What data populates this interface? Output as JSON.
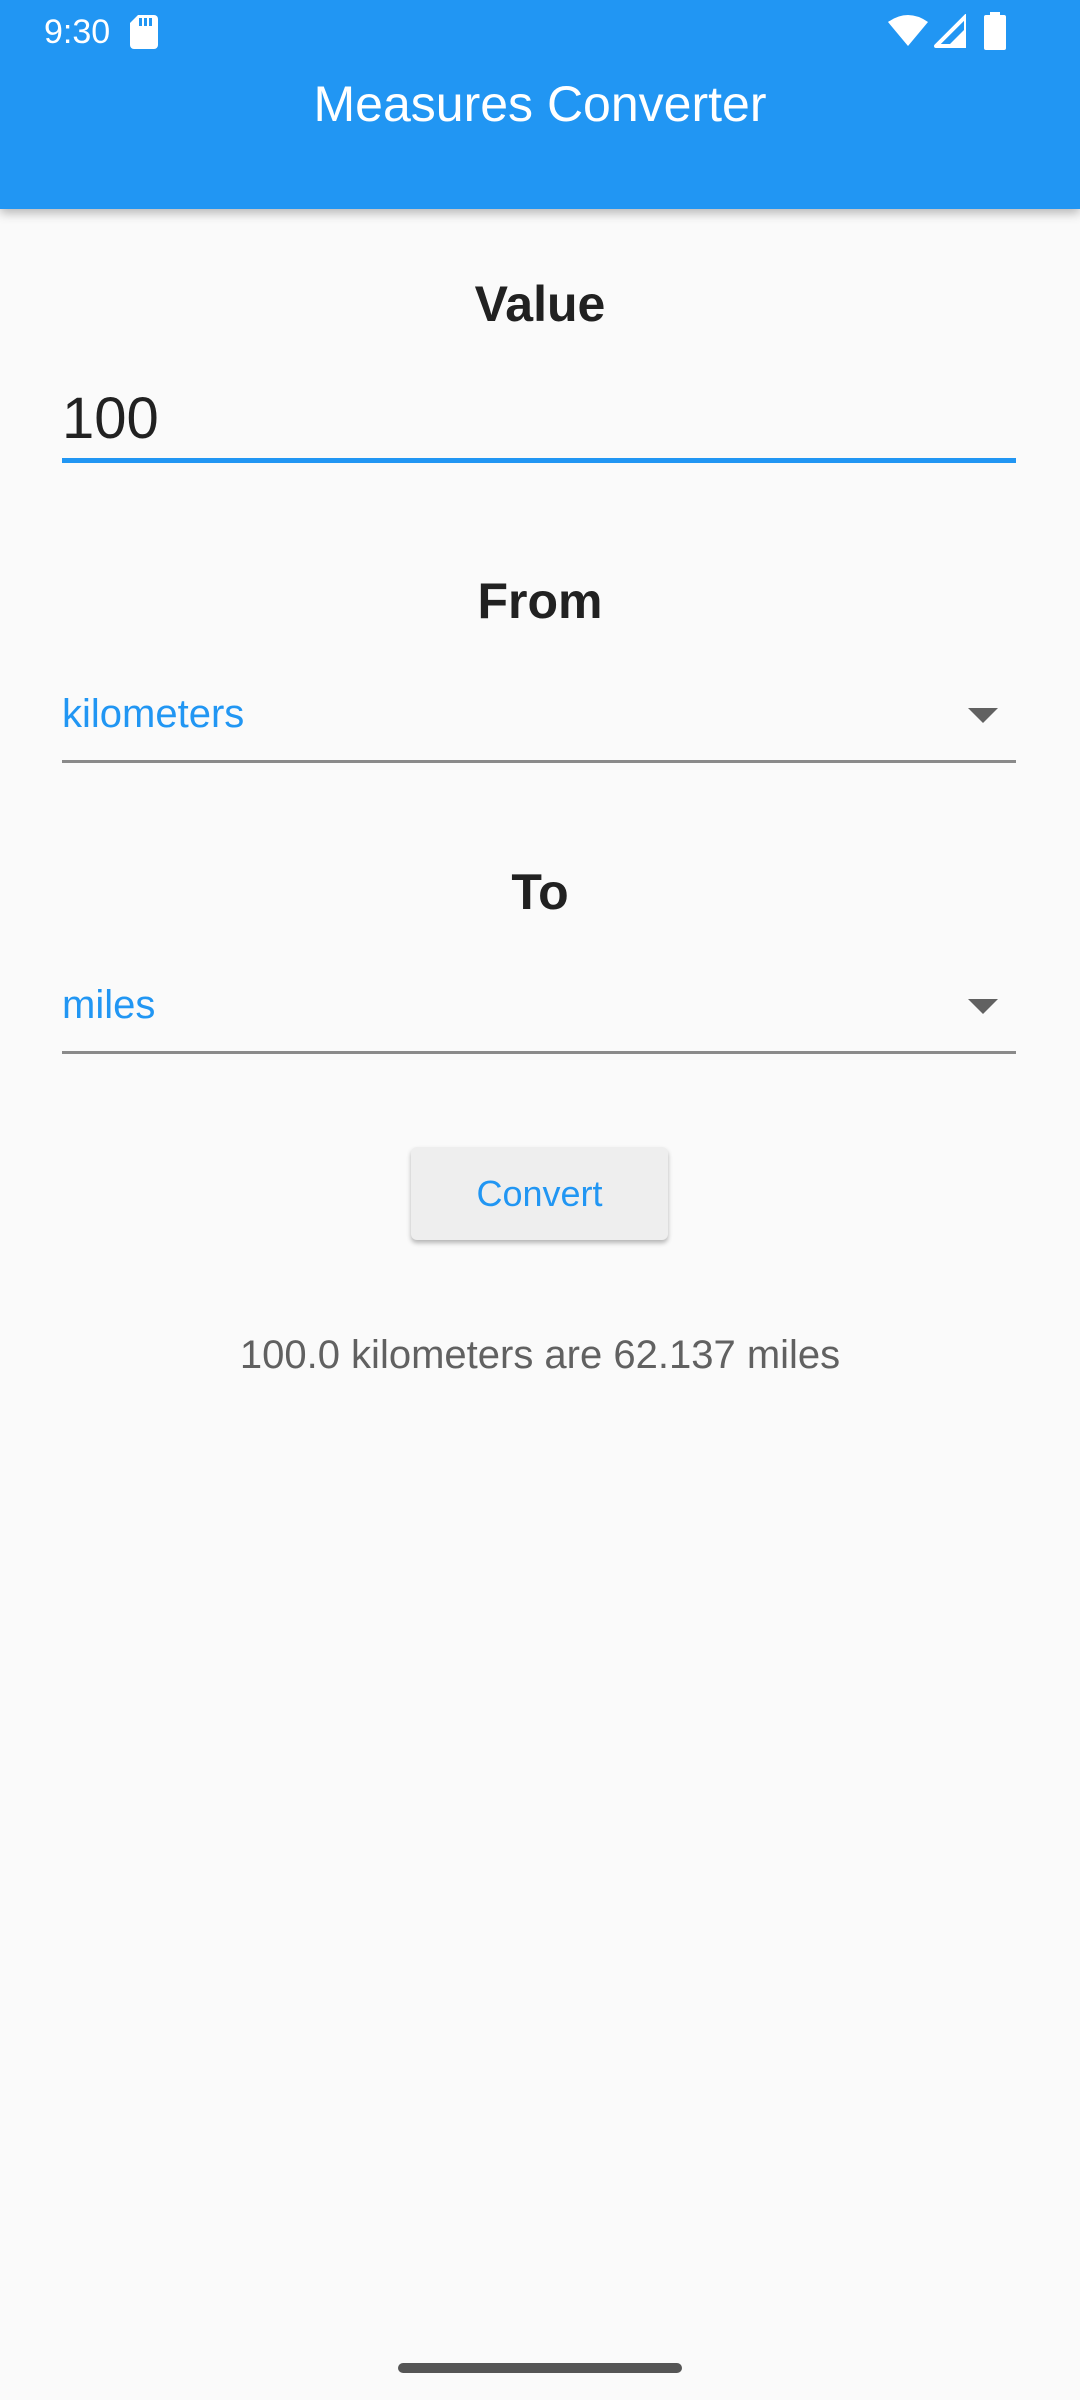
{
  "status_bar": {
    "time": "9:30",
    "icons": [
      "sd-card-icon",
      "wifi-icon",
      "cell-signal-icon",
      "battery-icon"
    ]
  },
  "app_bar": {
    "title": "Measures Converter",
    "color": "#2196f3"
  },
  "form": {
    "value_label": "Value",
    "value": "100",
    "from_label": "From",
    "from_selected": "kilometers",
    "to_label": "To",
    "to_selected": "miles",
    "convert_label": "Convert"
  },
  "result": {
    "text": "100.0 kilometers are 62.137 miles"
  },
  "colors": {
    "accent": "#2196f3",
    "background": "#fafafa"
  }
}
